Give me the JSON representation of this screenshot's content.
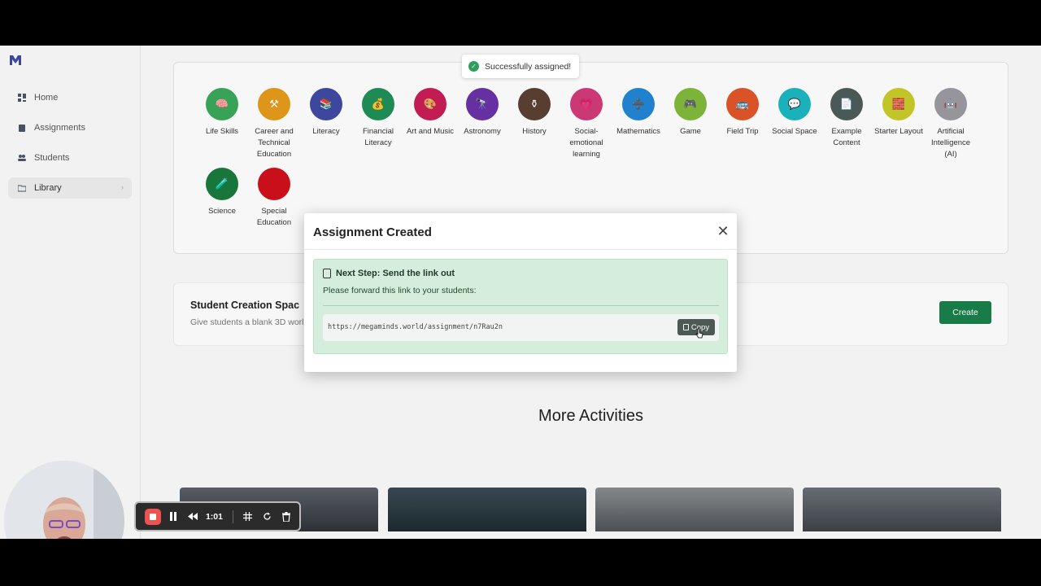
{
  "sidebar": {
    "items": [
      {
        "label": "Home",
        "icon": "home-icon"
      },
      {
        "label": "Assignments",
        "icon": "clipboard-icon"
      },
      {
        "label": "Students",
        "icon": "users-icon"
      },
      {
        "label": "Library",
        "icon": "folder-icon",
        "active": true
      }
    ]
  },
  "categories": [
    {
      "label": "Life Skills",
      "color": "#3aa85a",
      "glyph": "🧠"
    },
    {
      "label": "Career and Technical Education",
      "color": "#e59b1a",
      "glyph": "⚒"
    },
    {
      "label": "Literacy",
      "color": "#3e4aa3",
      "glyph": "📚"
    },
    {
      "label": "Financial Literacy",
      "color": "#1f8f57",
      "glyph": "💰"
    },
    {
      "label": "Art and Music",
      "color": "#c81d56",
      "glyph": "🎨"
    },
    {
      "label": "Astronomy",
      "color": "#6b32a8",
      "glyph": "🔭"
    },
    {
      "label": "History",
      "color": "#5a4032",
      "glyph": "⚱"
    },
    {
      "label": "Social-emotional learning",
      "color": "#d23b78",
      "glyph": "💗"
    },
    {
      "label": "Mathematics",
      "color": "#2287d6",
      "glyph": "➗"
    },
    {
      "label": "Game",
      "color": "#7fba3a",
      "glyph": "🎮"
    },
    {
      "label": "Field Trip",
      "color": "#e2562a",
      "glyph": "🚌"
    },
    {
      "label": "Social Space",
      "color": "#1cb7c0",
      "glyph": "💬"
    },
    {
      "label": "Example Content",
      "color": "#4d5b59",
      "glyph": "📄"
    },
    {
      "label": "Starter Layout",
      "color": "#c8cc2a",
      "glyph": "🧱"
    },
    {
      "label": "Artificial Intelligence (AI)",
      "color": "#9a9aa1",
      "glyph": "🤖"
    },
    {
      "label": "Science",
      "color": "#1a7a3d",
      "glyph": "🧪"
    },
    {
      "label": "Special Education",
      "color": "#d0101a",
      "glyph": ""
    }
  ],
  "creation": {
    "title": "Student Creation Spac",
    "desc": "Give students a blank 3D worl",
    "create_label": "Create"
  },
  "more_title": "More Activities",
  "toast": {
    "text": "Successfully assigned!"
  },
  "modal": {
    "title": "Assignment Created",
    "next_heading": "Next Step: Send the link out",
    "next_text": "Please forward this link to your students:",
    "link": "https://megaminds.world/assignment/n7Rau2n",
    "copy_label": "Copy"
  },
  "recorder": {
    "time": "1:01"
  },
  "colors": {
    "primary_green": "#1a7f4b",
    "success_box": "#d5eedb",
    "rec_red": "#ef5350"
  }
}
